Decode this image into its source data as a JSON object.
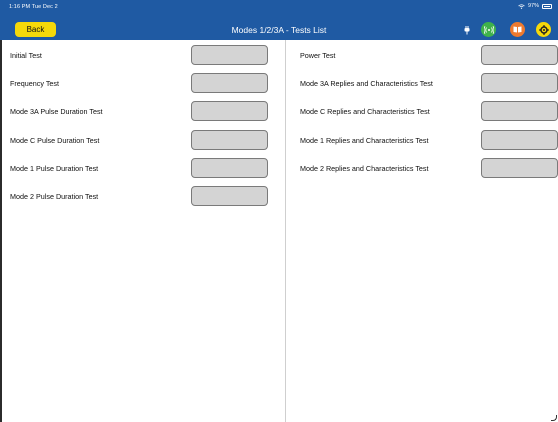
{
  "status_bar": {
    "time": "1:16 PM  Tue Dec 2",
    "battery": "97%"
  },
  "header": {
    "back_label": "Back",
    "title": "Modes 1/2/3A - Tests List"
  },
  "colors": {
    "header_bg": "#1f5aa3",
    "back_button": "#f5d90a",
    "wifi_button": "#3fb24a",
    "book_button": "#ee7a2e",
    "gear_button": "#f5d90a"
  },
  "icons": [
    "plug-icon",
    "wifi-icon",
    "book-icon",
    "gear-icon"
  ],
  "left_tests": [
    {
      "label": "Initial Test",
      "value": ""
    },
    {
      "label": "Frequency Test",
      "value": ""
    },
    {
      "label": "Mode 3A Pulse Duration Test",
      "value": ""
    },
    {
      "label": "Mode C Pulse Duration Test",
      "value": ""
    },
    {
      "label": "Mode 1 Pulse Duration Test",
      "value": ""
    },
    {
      "label": "Mode 2 Pulse Duration Test",
      "value": ""
    }
  ],
  "right_tests": [
    {
      "label": "Power Test",
      "value": ""
    },
    {
      "label": "Mode 3A Replies and Characteristics Test",
      "value": ""
    },
    {
      "label": "Mode C Replies and Characteristics Test",
      "value": ""
    },
    {
      "label": "Mode 1 Replies and Characteristics Test",
      "value": ""
    },
    {
      "label": "Mode 2 Replies and Characteristics Test",
      "value": ""
    }
  ]
}
